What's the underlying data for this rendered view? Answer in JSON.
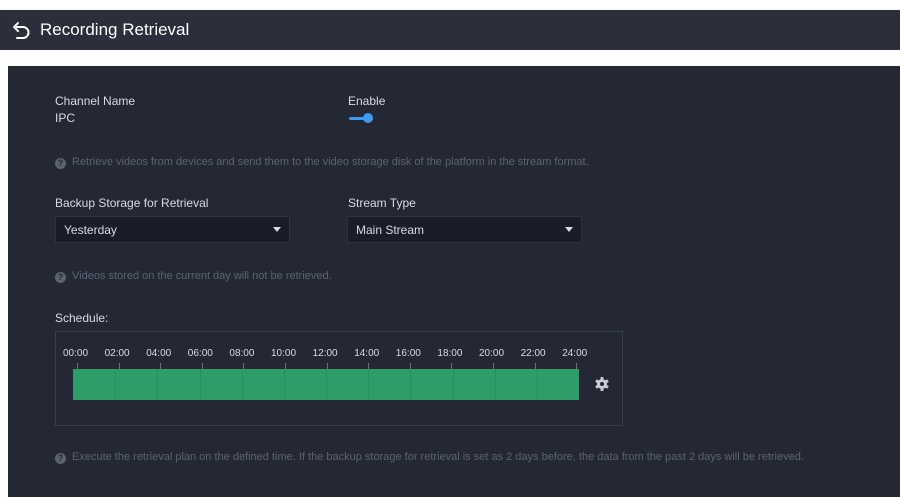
{
  "header": {
    "title": "Recording Retrieval",
    "back_icon": "back-arrow-icon"
  },
  "form": {
    "channel_name_label": "Channel Name",
    "channel_name_value": "IPC",
    "enable_label": "Enable",
    "enable_state": true,
    "hint1": "Retrieve videos from devices and send them to the video storage disk of the platform in the stream format.",
    "backup_label": "Backup Storage for Retrieval",
    "backup_value": "Yesterday",
    "stream_label": "Stream Type",
    "stream_value": "Main Stream",
    "hint2": "Videos stored on the current day will not be retrieved.",
    "schedule_label": "Schedule:",
    "schedule_ticks": [
      "00:00",
      "02:00",
      "04:00",
      "06:00",
      "08:00",
      "10:00",
      "12:00",
      "14:00",
      "16:00",
      "18:00",
      "20:00",
      "22:00",
      "24:00"
    ],
    "hint3": "Execute the retrieval plan on the defined time. If the backup storage for retrieval is set as 2 days before, the data from the past 2 days will be retrieved."
  },
  "colors": {
    "accent": "#3d9bf0",
    "schedule_fill": "#2d9e67",
    "panel_bg": "#242834",
    "header_bg": "#2b2e3b"
  },
  "icons": {
    "help": "question-circle-icon",
    "settings": "gear-icon",
    "dropdown": "caret-down-icon"
  }
}
